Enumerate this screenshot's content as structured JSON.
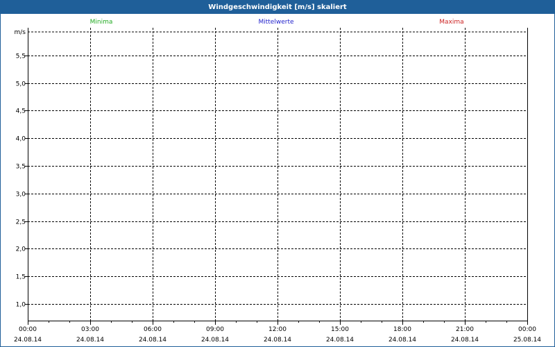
{
  "window": {
    "title": "Windgeschwindigkeit [m/s] skaliert"
  },
  "legend": [
    {
      "name": "Minima",
      "color": "#22aa22"
    },
    {
      "name": "Mittelwerte",
      "color": "#2222cc"
    },
    {
      "name": "Maxima",
      "color": "#cc2222"
    }
  ],
  "chart_data": {
    "type": "line",
    "title": "Windgeschwindigkeit [m/s] skaliert",
    "ylabel": "m/s",
    "ylim": [
      0.7,
      6.0
    ],
    "yticks": [
      1.0,
      1.5,
      2.0,
      2.5,
      3.0,
      3.5,
      4.0,
      4.5,
      5.0,
      5.5
    ],
    "ytick_labels": [
      "1,0",
      "1,5",
      "2,0",
      "2,5",
      "3,0",
      "3,5",
      "4,0",
      "4,5",
      "5,0",
      "5,5"
    ],
    "xticks": [
      {
        "time": "00:00",
        "date": "24.08.14"
      },
      {
        "time": "03:00",
        "date": "24.08.14"
      },
      {
        "time": "06:00",
        "date": "24.08.14"
      },
      {
        "time": "09:00",
        "date": "24.08.14"
      },
      {
        "time": "12:00",
        "date": "24.08.14"
      },
      {
        "time": "15:00",
        "date": "24.08.14"
      },
      {
        "time": "18:00",
        "date": "24.08.14"
      },
      {
        "time": "21:00",
        "date": "24.08.14"
      },
      {
        "time": "00:00",
        "date": "25.08.14"
      }
    ],
    "grid": true,
    "legend_position": "top",
    "series": [
      {
        "name": "Minima",
        "values": []
      },
      {
        "name": "Mittelwerte",
        "values": []
      },
      {
        "name": "Maxima",
        "values": []
      }
    ]
  }
}
